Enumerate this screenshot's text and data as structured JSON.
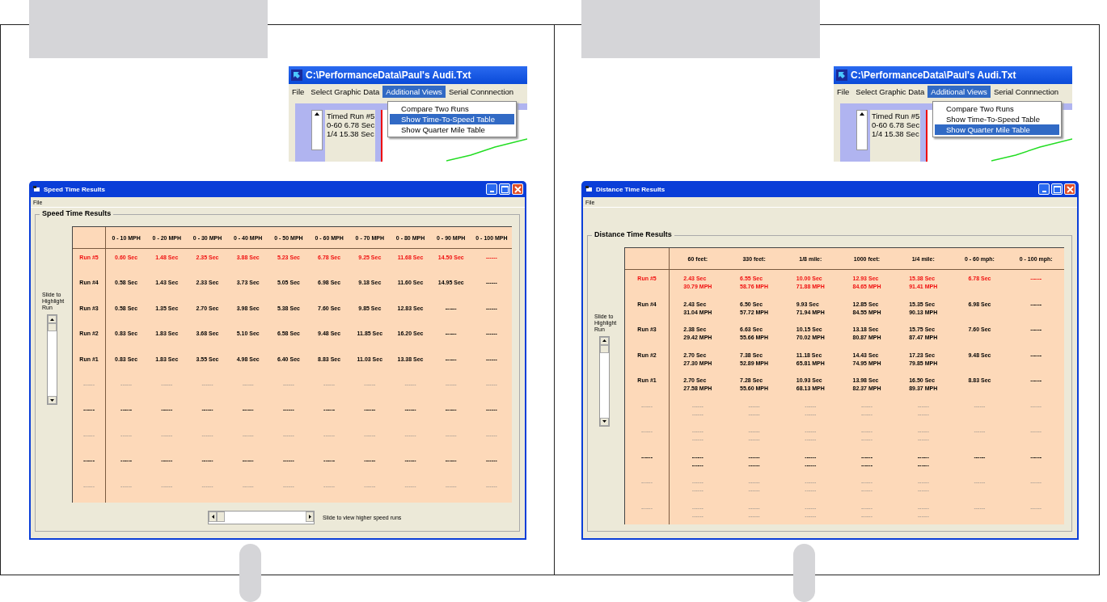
{
  "panels": [
    {
      "menu_shot": {
        "title": "C:\\PerformanceData\\Paul's Audi.Txt",
        "menu": [
          {
            "label": "File",
            "selected": false
          },
          {
            "label": "Select Graphic Data",
            "selected": false
          },
          {
            "label": "Additional Views",
            "selected": true
          },
          {
            "label": "Serial Connnection",
            "selected": false
          }
        ],
        "dropdown": [
          {
            "label": "Compare Two Runs",
            "selected": false
          },
          {
            "label": "Show Time-To-Speed Table",
            "selected": true
          },
          {
            "label": "Show Quarter Mile Table",
            "selected": false
          }
        ],
        "info": [
          "Timed Run #5",
          "0-60 6.78 Sec",
          "1/4 15.38 Sec"
        ]
      },
      "window": {
        "title": "Speed Time Results",
        "menu": [
          "File"
        ],
        "group_title": "Speed Time Results",
        "slider_label": "Slide to Highlight Run",
        "hscroll_label": "Slide to view higher speed runs",
        "columns": [
          "0 - 10 MPH",
          "0 - 20 MPH",
          "0 - 30 MPH",
          "0 - 40 MPH",
          "0 - 50 MPH",
          "0 - 60 MPH",
          "0 - 70 MPH",
          "0 - 80 MPH",
          "0 - 90 MPH",
          "0 - 100 MPH"
        ],
        "rows": [
          {
            "kind": "highlight",
            "label": "Run #5",
            "cells": [
              [
                "0.60 Sec"
              ],
              [
                "1.48 Sec"
              ],
              [
                "2.35 Sec"
              ],
              [
                "3.88 Sec"
              ],
              [
                "5.23 Sec"
              ],
              [
                "6.78 Sec"
              ],
              [
                "9.25 Sec"
              ],
              [
                "11.68 Sec"
              ],
              [
                "14.50 Sec"
              ],
              [
                "------"
              ]
            ]
          },
          {
            "kind": "data",
            "label": "Run #4",
            "cells": [
              [
                "0.58 Sec"
              ],
              [
                "1.43 Sec"
              ],
              [
                "2.33 Sec"
              ],
              [
                "3.73 Sec"
              ],
              [
                "5.05 Sec"
              ],
              [
                "6.98 Sec"
              ],
              [
                "9.18 Sec"
              ],
              [
                "11.60 Sec"
              ],
              [
                "14.95 Sec"
              ],
              [
                "------"
              ]
            ]
          },
          {
            "kind": "data",
            "label": "Run #3",
            "cells": [
              [
                "0.58 Sec"
              ],
              [
                "1.35 Sec"
              ],
              [
                "2.70 Sec"
              ],
              [
                "3.98 Sec"
              ],
              [
                "5.38 Sec"
              ],
              [
                "7.60 Sec"
              ],
              [
                "9.85 Sec"
              ],
              [
                "12.83 Sec"
              ],
              [
                "------"
              ],
              [
                "------"
              ]
            ]
          },
          {
            "kind": "data",
            "label": "Run #2",
            "cells": [
              [
                "0.83 Sec"
              ],
              [
                "1.83 Sec"
              ],
              [
                "3.68 Sec"
              ],
              [
                "5.10 Sec"
              ],
              [
                "6.58 Sec"
              ],
              [
                "9.48 Sec"
              ],
              [
                "11.85 Sec"
              ],
              [
                "16.20 Sec"
              ],
              [
                "------"
              ],
              [
                "------"
              ]
            ]
          },
          {
            "kind": "data",
            "label": "Run #1",
            "cells": [
              [
                "0.83 Sec"
              ],
              [
                "1.83 Sec"
              ],
              [
                "3.55 Sec"
              ],
              [
                "4.98 Sec"
              ],
              [
                "6.40 Sec"
              ],
              [
                "8.83 Sec"
              ],
              [
                "11.03 Sec"
              ],
              [
                "13.38 Sec"
              ],
              [
                "------"
              ],
              [
                "------"
              ]
            ]
          },
          {
            "kind": "empty",
            "label": "------",
            "cells": [
              [
                "------"
              ],
              [
                "------"
              ],
              [
                "------"
              ],
              [
                "------"
              ],
              [
                "------"
              ],
              [
                "------"
              ],
              [
                "------"
              ],
              [
                "------"
              ],
              [
                "------"
              ],
              [
                "------"
              ]
            ]
          },
          {
            "kind": "empty-bold",
            "label": "------",
            "cells": [
              [
                "------"
              ],
              [
                "------"
              ],
              [
                "------"
              ],
              [
                "------"
              ],
              [
                "------"
              ],
              [
                "------"
              ],
              [
                "------"
              ],
              [
                "------"
              ],
              [
                "------"
              ],
              [
                "------"
              ]
            ]
          },
          {
            "kind": "empty",
            "label": "------",
            "cells": [
              [
                "------"
              ],
              [
                "------"
              ],
              [
                "------"
              ],
              [
                "------"
              ],
              [
                "------"
              ],
              [
                "------"
              ],
              [
                "------"
              ],
              [
                "------"
              ],
              [
                "------"
              ],
              [
                "------"
              ]
            ]
          },
          {
            "kind": "empty-bold",
            "label": "------",
            "cells": [
              [
                "------"
              ],
              [
                "------"
              ],
              [
                "------"
              ],
              [
                "------"
              ],
              [
                "------"
              ],
              [
                "------"
              ],
              [
                "------"
              ],
              [
                "------"
              ],
              [
                "------"
              ],
              [
                "------"
              ]
            ]
          },
          {
            "kind": "empty",
            "label": "------",
            "cells": [
              [
                "------"
              ],
              [
                "------"
              ],
              [
                "------"
              ],
              [
                "------"
              ],
              [
                "------"
              ],
              [
                "------"
              ],
              [
                "------"
              ],
              [
                "------"
              ],
              [
                "------"
              ],
              [
                "------"
              ]
            ]
          }
        ]
      }
    },
    {
      "menu_shot": {
        "title": "C:\\PerformanceData\\Paul's Audi.Txt",
        "menu": [
          {
            "label": "File",
            "selected": false
          },
          {
            "label": "Select Graphic Data",
            "selected": false
          },
          {
            "label": "Additional Views",
            "selected": true
          },
          {
            "label": "Serial Connnection",
            "selected": false
          }
        ],
        "dropdown": [
          {
            "label": "Compare Two Runs",
            "selected": false
          },
          {
            "label": "Show Time-To-Speed Table",
            "selected": false
          },
          {
            "label": "Show Quarter Mile Table",
            "selected": true
          }
        ],
        "info": [
          "Timed Run #5",
          "0-60 6.78 Sec",
          "1/4 15.38 Sec"
        ]
      },
      "window": {
        "title": "Distance Time Results",
        "menu": [
          "File"
        ],
        "group_title": "Distance Time Results",
        "slider_label": "Slide to Highlight Run",
        "columns": [
          "60 feet:",
          "330 feet:",
          "1/8 mile:",
          "1000 feet:",
          "1/4 mile:",
          "0 - 60 mph:",
          "0 - 100 mph:"
        ],
        "rows": [
          {
            "kind": "highlight",
            "label": "Run #5",
            "cells": [
              [
                "2.43 Sec",
                "30.79 MPH"
              ],
              [
                "6.55 Sec",
                "58.76 MPH"
              ],
              [
                "10.00 Sec",
                "71.88 MPH"
              ],
              [
                "12.93 Sec",
                "84.65 MPH"
              ],
              [
                "15.38 Sec",
                "91.41 MPH"
              ],
              [
                "6.78 Sec"
              ],
              [
                "------"
              ]
            ]
          },
          {
            "kind": "data",
            "label": "Run #4",
            "cells": [
              [
                "2.43 Sec",
                "31.04 MPH"
              ],
              [
                "6.50 Sec",
                "57.72 MPH"
              ],
              [
                "9.93 Sec",
                "71.94 MPH"
              ],
              [
                "12.85 Sec",
                "84.55 MPH"
              ],
              [
                "15.35 Sec",
                "90.13 MPH"
              ],
              [
                "6.98 Sec"
              ],
              [
                "------"
              ]
            ]
          },
          {
            "kind": "data",
            "label": "Run #3",
            "cells": [
              [
                "2.38 Sec",
                "29.42 MPH"
              ],
              [
                "6.63 Sec",
                "55.66 MPH"
              ],
              [
                "10.15 Sec",
                "70.02 MPH"
              ],
              [
                "13.18 Sec",
                "80.87 MPH"
              ],
              [
                "15.75 Sec",
                "87.47 MPH"
              ],
              [
                "7.60 Sec"
              ],
              [
                "------"
              ]
            ]
          },
          {
            "kind": "data",
            "label": "Run #2",
            "cells": [
              [
                "2.70 Sec",
                "27.30 MPH"
              ],
              [
                "7.38 Sec",
                "52.89 MPH"
              ],
              [
                "11.18 Sec",
                "65.81 MPH"
              ],
              [
                "14.43 Sec",
                "74.95 MPH"
              ],
              [
                "17.23 Sec",
                "79.85 MPH"
              ],
              [
                "9.48 Sec"
              ],
              [
                "------"
              ]
            ]
          },
          {
            "kind": "data",
            "label": "Run #1",
            "cells": [
              [
                "2.70 Sec",
                "27.58 MPH"
              ],
              [
                "7.28 Sec",
                "55.60 MPH"
              ],
              [
                "10.93 Sec",
                "68.13 MPH"
              ],
              [
                "13.98 Sec",
                "82.37 MPH"
              ],
              [
                "16.50 Sec",
                "89.37 MPH"
              ],
              [
                "8.83 Sec"
              ],
              [
                "------"
              ]
            ]
          },
          {
            "kind": "empty",
            "label": "------",
            "cells": [
              [
                "------",
                "------"
              ],
              [
                "------",
                "------"
              ],
              [
                "------",
                "------"
              ],
              [
                "------",
                "------"
              ],
              [
                "------",
                "------"
              ],
              [
                "------"
              ],
              [
                "------"
              ]
            ]
          },
          {
            "kind": "empty",
            "label": "------",
            "cells": [
              [
                "------",
                "------"
              ],
              [
                "------",
                "------"
              ],
              [
                "------",
                "------"
              ],
              [
                "------",
                "------"
              ],
              [
                "------",
                "------"
              ],
              [
                "------"
              ],
              [
                "------"
              ]
            ]
          },
          {
            "kind": "empty-bold",
            "label": "------",
            "cells": [
              [
                "------",
                "------"
              ],
              [
                "------",
                "------"
              ],
              [
                "------",
                "------"
              ],
              [
                "------",
                "------"
              ],
              [
                "------",
                "------"
              ],
              [
                "------"
              ],
              [
                "------"
              ]
            ]
          },
          {
            "kind": "empty",
            "label": "------",
            "cells": [
              [
                "------",
                "------"
              ],
              [
                "------",
                "------"
              ],
              [
                "------",
                "------"
              ],
              [
                "------",
                "------"
              ],
              [
                "------",
                "------"
              ],
              [
                "------"
              ],
              [
                "------"
              ]
            ]
          },
          {
            "kind": "empty",
            "label": "------",
            "cells": [
              [
                "------",
                "------"
              ],
              [
                "------",
                "------"
              ],
              [
                "------",
                "------"
              ],
              [
                "------",
                "------"
              ],
              [
                "------",
                "------"
              ],
              [
                "------"
              ],
              [
                "------"
              ]
            ]
          }
        ]
      }
    }
  ]
}
